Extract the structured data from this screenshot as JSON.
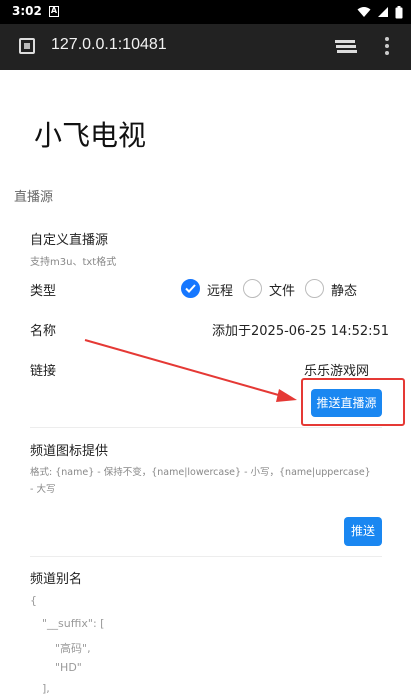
{
  "status": {
    "time": "3:02",
    "notif": "A"
  },
  "browser": {
    "url": "127.0.0.1:10481"
  },
  "app": {
    "title": "小飞电视"
  },
  "section": {
    "title": "直播源"
  },
  "custom_source": {
    "title": "自定义直播源",
    "subtitle": "支持m3u、txt格式",
    "type_label": "类型",
    "options": [
      "远程",
      "文件",
      "静态"
    ],
    "selected_option": "远程",
    "name_label": "名称",
    "name_value": "添加于2025-06-25 14:52:51",
    "link_label": "链接",
    "link_value": "乐乐游戏网",
    "push_button": "推送直播源"
  },
  "icon_provider": {
    "title": "频道图标提供",
    "format_line1": "格式: {name} - 保持不变，{name|lowercase} - 小写，{name|uppercase}",
    "format_line2": "- 大写",
    "push_button": "推送"
  },
  "alias": {
    "title": "频道别名",
    "lines": [
      "{",
      "\"__suffix\": [",
      "\"高码\",",
      "\"HD\"",
      "],"
    ]
  },
  "colors": {
    "accent": "#1a87f1",
    "annotation": "#e53935",
    "topbar": "#222222"
  }
}
